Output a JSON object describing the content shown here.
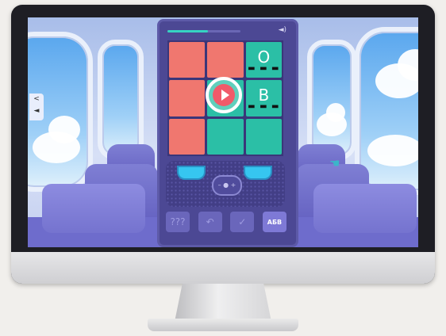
{
  "game": {
    "progress_fraction": 0.55,
    "sound_icon": "speaker-icon",
    "grid": [
      {
        "color": "#f0776f",
        "letter": "",
        "dots": ""
      },
      {
        "color": "#f0776f",
        "letter": "",
        "dots": ""
      },
      {
        "color": "#2bbfa6",
        "letter": "O",
        "dots": "▬ ▬ ▬"
      },
      {
        "color": "#f0776f",
        "letter": "",
        "dots": ""
      },
      {
        "color": "#2bbfa6",
        "letter": "",
        "dots": ""
      },
      {
        "color": "#2bbfa6",
        "letter": "B",
        "dots": "▬ ▬ ▬"
      },
      {
        "color": "#f0776f",
        "letter": "",
        "dots": ""
      },
      {
        "color": "#2bbfa6",
        "letter": "",
        "dots": ""
      },
      {
        "color": "#2bbfa6",
        "letter": "",
        "dots": ""
      }
    ],
    "buttons": {
      "hint": "???",
      "undo": "↶",
      "check": "✓",
      "alphabet": "АБВ"
    },
    "side_controls": {
      "back": "<",
      "sound": "◄"
    }
  }
}
